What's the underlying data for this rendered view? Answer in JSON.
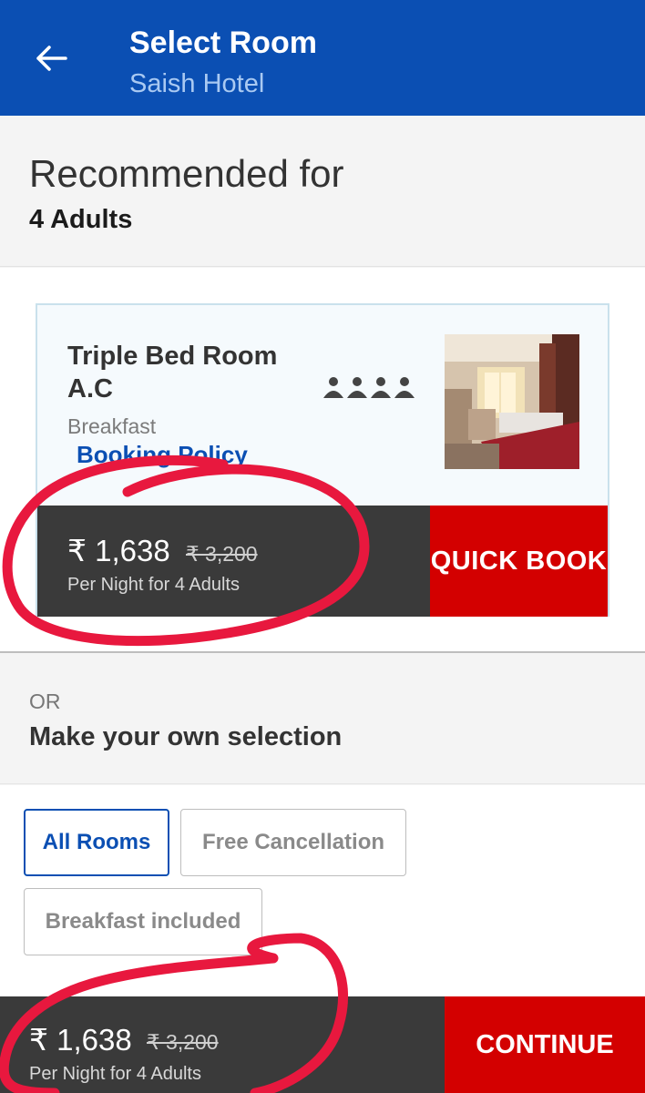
{
  "header": {
    "title": "Select Room",
    "subtitle": "Saish Hotel"
  },
  "recommended": {
    "title": "Recommended for",
    "guests": "4 Adults"
  },
  "room_card": {
    "name": "Triple Bed Room A.C",
    "meal": "Breakfast",
    "policy_link": "Booking Policy",
    "guest_count_icons": 4,
    "price": "₹ 1,638",
    "original_price": "₹ 3,200",
    "price_note": "Per Night for 4 Adults",
    "cta": "QUICK BOOK"
  },
  "own_selection": {
    "or_label": "OR",
    "title": "Make your own selection"
  },
  "filters": [
    {
      "label": "All Rooms",
      "active": true
    },
    {
      "label": "Free Cancellation",
      "active": false
    },
    {
      "label": "Breakfast included",
      "active": false
    }
  ],
  "bottom_bar": {
    "price": "₹ 1,638",
    "original_price": "₹ 3,200",
    "price_note": "Per Night for 4 Adults",
    "cta": "CONTINUE"
  },
  "colors": {
    "brand_blue": "#0b4fb3",
    "cta_red": "#d30000",
    "price_bar": "#3a3a3a",
    "annotation_red": "#e8183e"
  }
}
